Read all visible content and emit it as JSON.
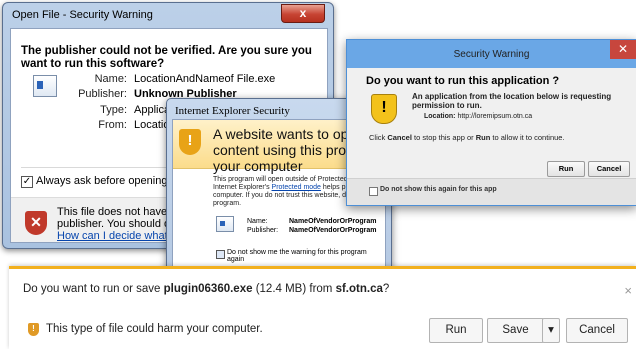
{
  "open_file_dialog": {
    "title": "Open File - Security Warning",
    "close_glyph": "x",
    "question": "The publisher could not be verified.  Are you sure you want to run this software?",
    "fields": [
      {
        "label": "Name:",
        "value": "LocationAndNameof File.exe"
      },
      {
        "label": "Publisher:",
        "value": "Unknown Publisher"
      },
      {
        "label": "Type:",
        "value": "Application"
      },
      {
        "label": "From:",
        "value": "LocationAndN"
      }
    ],
    "checkbox_label": "Always ask before opening this file",
    "checkbox_checked": true,
    "warning_line1": "This file does not have a valid",
    "warning_line2": "publisher.  You should only run",
    "help_link": "How can I decide what softw"
  },
  "ie_security_dialog": {
    "title": "Internet Explorer Security",
    "heading": "A website wants to open web content using this program on your computer",
    "body_pre": "This program will open outside of Protected mode. Internet Explorer's ",
    "body_link": "Protected mode",
    "body_post": " helps protect your computer. If you do not trust this website, do not open this program.",
    "name_label": "Name:",
    "name_value": "NameOfVendorOrProgram",
    "publisher_label": "Publisher:",
    "publisher_value": "NameOfVendorOrProgram",
    "checkbox_label": "Do not show me the warning for this program again"
  },
  "security_warning_dialog": {
    "title": "Security Warning",
    "close_glyph": "✕",
    "question": "Do you want to run this application ?",
    "description": "An application from the location below is requesting permission to run.",
    "location_label": "Location:",
    "location_value": "http://loremipsum.otn.ca",
    "instruction_pre": "Click ",
    "instruction_cancel": "Cancel",
    "instruction_mid": " to stop this app or ",
    "instruction_run": "Run",
    "instruction_post": " to allow it to continue.",
    "run_button": "Run",
    "cancel_button": "Cancel",
    "checkbox_label": "Do not show this again for this app"
  },
  "download_bar": {
    "prompt_pre": "Do you want to run or save ",
    "file_name": "plugin06360.exe",
    "prompt_size": " (12.4 MB) from ",
    "source": "sf.otn.ca",
    "prompt_post": "?",
    "warning": "This type of file could harm your computer.",
    "run_button": "Run",
    "save_button": "Save",
    "save_dropdown_glyph": "▾",
    "cancel_button": "Cancel",
    "close_glyph": "×",
    "accent_color": "#f2b01e"
  }
}
